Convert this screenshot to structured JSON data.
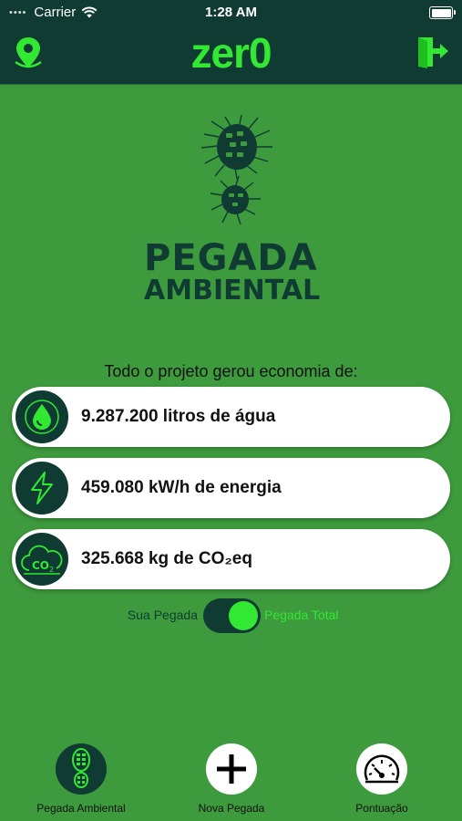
{
  "status_bar": {
    "carrier": "Carrier",
    "time": "1:28 AM"
  },
  "header": {
    "title": "zer0"
  },
  "logo": {
    "line1": "PEGADA",
    "line2": "AMBIENTAL"
  },
  "intro": "Todo o projeto gerou economia de:",
  "stats": [
    {
      "icon": "water-drop-icon",
      "text": "9.287.200 litros de água"
    },
    {
      "icon": "lightning-icon",
      "text": "459.080 kW/h de energia"
    },
    {
      "icon": "co2-cloud-icon",
      "text": "325.668 kg de CO₂eq"
    }
  ],
  "toggle": {
    "left_label": "Sua Pegada",
    "right_label": "Pegada Total",
    "state": "on"
  },
  "nav": [
    {
      "label": "Pegada Ambiental",
      "icon": "footprint-icon",
      "active": true
    },
    {
      "label": "Nova Pegada",
      "icon": "plus-icon",
      "active": false
    },
    {
      "label": "Pontuação",
      "icon": "speedometer-icon",
      "active": false
    }
  ],
  "colors": {
    "dark": "#0f3b33",
    "accent": "#32e832",
    "background": "#3d9a3d"
  }
}
